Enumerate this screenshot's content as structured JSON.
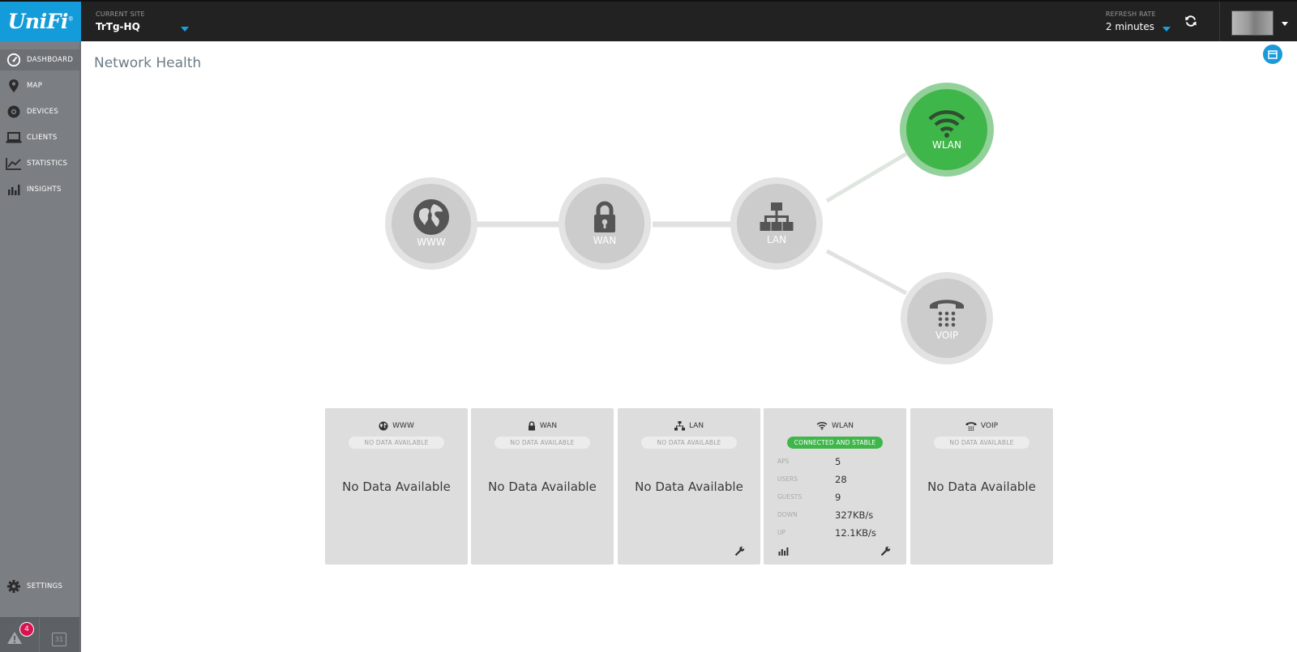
{
  "brand": {
    "logo_text": "UniFi",
    "logo_mark": "®"
  },
  "header": {
    "site_caption": "CURRENT SITE",
    "site_name": "TrTg-HQ",
    "refresh_caption": "REFRESH RATE",
    "refresh_value": "2 minutes"
  },
  "sidebar": {
    "items": [
      {
        "label": "DASHBOARD",
        "icon": "dashboard-icon",
        "active": true
      },
      {
        "label": "MAP",
        "icon": "map-pin-icon"
      },
      {
        "label": "DEVICES",
        "icon": "devices-icon"
      },
      {
        "label": "CLIENTS",
        "icon": "laptop-icon"
      },
      {
        "label": "STATISTICS",
        "icon": "line-chart-icon"
      },
      {
        "label": "INSIGHTS",
        "icon": "bar-chart-icon"
      }
    ],
    "settings_label": "SETTINGS",
    "alert_count": "4",
    "calendar_day": "31"
  },
  "main": {
    "title": "Network Health",
    "topology": {
      "www": "WWW",
      "wan": "WAN",
      "lan": "LAN",
      "wlan": "WLAN",
      "voip": "VOIP"
    },
    "cards": {
      "www": {
        "title": "WWW",
        "status": "NO DATA AVAILABLE",
        "body": "No Data Available"
      },
      "wan": {
        "title": "WAN",
        "status": "NO DATA AVAILABLE",
        "body": "No Data Available"
      },
      "lan": {
        "title": "LAN",
        "status": "NO DATA AVAILABLE",
        "body": "No Data Available"
      },
      "wlan": {
        "title": "WLAN",
        "status": "CONNECTED AND STABLE",
        "stats": [
          {
            "key": "APS",
            "value": "5"
          },
          {
            "key": "USERS",
            "value": "28"
          },
          {
            "key": "GUESTS",
            "value": "9"
          },
          {
            "key": "DOWN",
            "value": "327KB/s"
          },
          {
            "key": "UP",
            "value": "12.1KB/s"
          }
        ]
      },
      "voip": {
        "title": "VOIP",
        "status": "NO DATA AVAILABLE",
        "body": "No Data Available"
      }
    }
  },
  "colors": {
    "accent": "#139cd9",
    "healthy": "#3fb64a",
    "alert": "#d8134f",
    "inactive": "#cccccc"
  }
}
